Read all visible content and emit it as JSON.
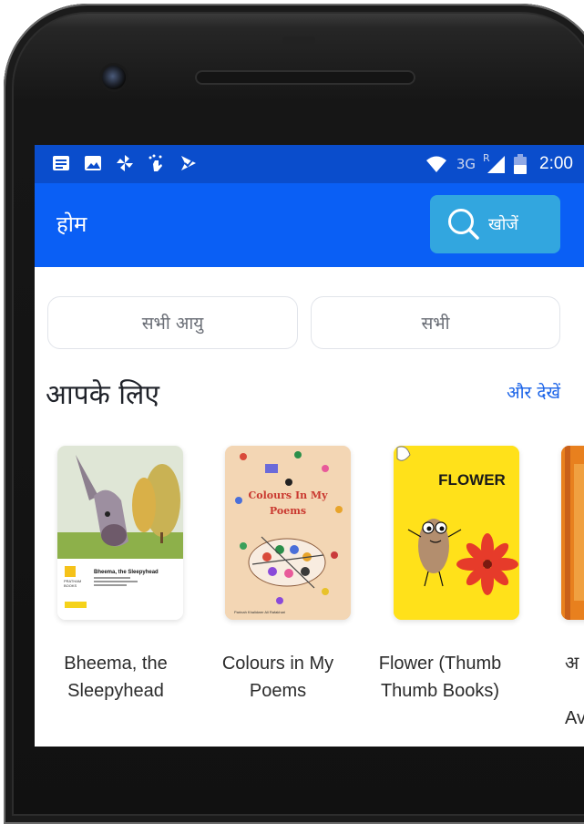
{
  "status_bar": {
    "left_icons": [
      "notes-icon",
      "image-icon",
      "pinwheel-icon",
      "sparkle-hand-icon",
      "check-flag-icon"
    ],
    "network": "3G",
    "roaming": "R",
    "time": "2:00"
  },
  "app_bar": {
    "title": "होम",
    "search_label": "खोजें"
  },
  "filters": [
    {
      "label": "सभी आयु"
    },
    {
      "label": "सभी"
    }
  ],
  "section": {
    "title": "आपके लिए",
    "see_more": "और देखें"
  },
  "books": [
    {
      "title_line1": "Bheema, the",
      "title_line2": "Sleepyhead",
      "cover_text": "Bheema, the Sleepyhead",
      "publisher_logo": "PRATHAM BOOKS",
      "level": "Level 1"
    },
    {
      "title_line1": "Colours in My",
      "title_line2": "Poems",
      "cover_text": "Colours In My Poems",
      "cover_authors": "Parinah Khalidwer        Ali Rafakhari"
    },
    {
      "title_line1": "Flower (Thumb",
      "title_line2": "Thumb Books)",
      "cover_text": "FLOWER"
    },
    {
      "title_line1": "अ",
      "title_line2": "",
      "title_line3": "Av"
    }
  ],
  "colors": {
    "status_bar": "#0a4dcc",
    "app_bar": "#0a5ff5",
    "search_button": "#32a6df",
    "link": "#1a63e8"
  }
}
